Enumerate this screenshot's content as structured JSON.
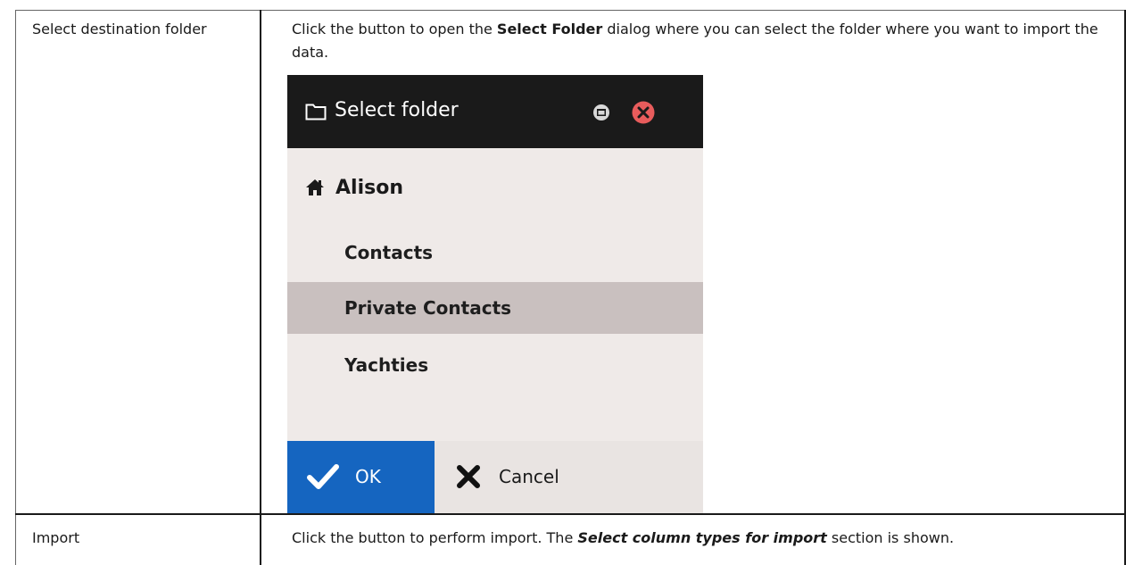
{
  "row1": {
    "label": "Select destination folder",
    "desc_part1": "Click the button to open the ",
    "desc_bold": "Select Folder",
    "desc_part2": " dialog where you can select the folder where you want to import the data."
  },
  "dialog": {
    "title": "Select folder",
    "root": "Alison",
    "items": [
      "Contacts",
      "Private Contacts",
      "Yachties"
    ],
    "selected_item": "Private Contacts",
    "ok_label": "OK",
    "cancel_label": "Cancel",
    "colors": {
      "title_bar": "#1a1a1a",
      "ok": "#1565c0",
      "close": "#e85c5c",
      "selected": "#c9c0bf"
    }
  },
  "row2": {
    "label": "Import",
    "desc_part1": "Click the button to perform import. The ",
    "desc_bold_italic": "Select column types for import",
    "desc_part2": " section is shown."
  }
}
